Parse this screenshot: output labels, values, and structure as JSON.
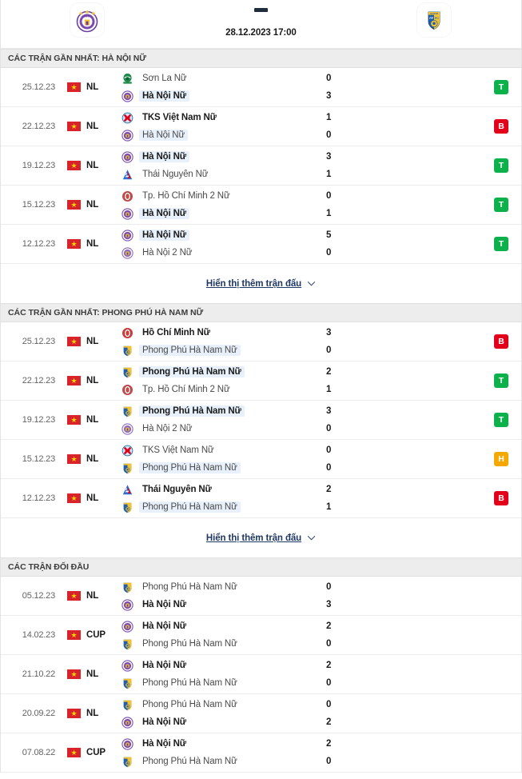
{
  "header": {
    "home_team": "Hà Nội Nữ",
    "away_team": "Phong Phú Hà Nam Nữ",
    "score_placeholder": "-",
    "kickoff": "28.12.2023 17:00",
    "home_crest_icon": "hanoi-crest-icon",
    "away_crest_icon": "phongphu-hanam-crest-icon"
  },
  "colors": {
    "win": "#0db14b",
    "loss": "#e2001a",
    "draw": "#f5a800",
    "highlight": "#e8f1fb",
    "section_bar": "#ededed",
    "link": "#1f3864",
    "flag_red": "#d8232a",
    "flag_star": "#ffd400"
  },
  "show_more_label": "Hiển thị thêm trận đấu",
  "sections": [
    {
      "title": "CÁC TRẬN GẦN NHẤT: HÀ NỘI NỮ",
      "has_show_more": true,
      "matches": [
        {
          "date": "25.12.23",
          "competition": "NL",
          "flag": "vietnam-flag",
          "home": {
            "name": "Sơn La Nữ",
            "logo": "sonla-logo",
            "bold": false,
            "highlight": false
          },
          "away": {
            "name": "Hà Nội Nữ",
            "logo": "hanoi-logo",
            "bold": true,
            "highlight": true
          },
          "home_score": "0",
          "away_score": "3",
          "result": "T",
          "result_type": "win"
        },
        {
          "date": "22.12.23",
          "competition": "NL",
          "flag": "vietnam-flag",
          "home": {
            "name": "TKS Việt Nam Nữ",
            "logo": "tks-logo",
            "bold": true,
            "highlight": false
          },
          "away": {
            "name": "Hà Nội Nữ",
            "logo": "hanoi-logo",
            "bold": false,
            "highlight": true
          },
          "home_score": "1",
          "away_score": "0",
          "result": "B",
          "result_type": "loss"
        },
        {
          "date": "19.12.23",
          "competition": "NL",
          "flag": "vietnam-flag",
          "home": {
            "name": "Hà Nội Nữ",
            "logo": "hanoi-logo",
            "bold": true,
            "highlight": true
          },
          "away": {
            "name": "Thái Nguyên Nữ",
            "logo": "thainguyen-logo",
            "bold": false,
            "highlight": false
          },
          "home_score": "3",
          "away_score": "1",
          "result": "T",
          "result_type": "win"
        },
        {
          "date": "15.12.23",
          "competition": "NL",
          "flag": "vietnam-flag",
          "home": {
            "name": "Tp. Hồ Chí Minh 2 Nữ",
            "logo": "hcm2-logo",
            "bold": false,
            "highlight": false
          },
          "away": {
            "name": "Hà Nội Nữ",
            "logo": "hanoi-logo",
            "bold": true,
            "highlight": true
          },
          "home_score": "0",
          "away_score": "1",
          "result": "T",
          "result_type": "win"
        },
        {
          "date": "12.12.23",
          "competition": "NL",
          "flag": "vietnam-flag",
          "home": {
            "name": "Hà Nội Nữ",
            "logo": "hanoi-logo",
            "bold": true,
            "highlight": true
          },
          "away": {
            "name": "Hà Nội 2 Nữ",
            "logo": "hanoi2-logo",
            "bold": false,
            "highlight": false
          },
          "home_score": "5",
          "away_score": "0",
          "result": "T",
          "result_type": "win"
        }
      ]
    },
    {
      "title": "CÁC TRẬN GẦN NHẤT: PHONG PHÚ HÀ NAM NỮ",
      "has_show_more": true,
      "matches": [
        {
          "date": "25.12.23",
          "competition": "NL",
          "flag": "vietnam-flag",
          "home": {
            "name": "Hồ Chí Minh Nữ",
            "logo": "hcm-logo",
            "bold": true,
            "highlight": false
          },
          "away": {
            "name": "Phong Phú Hà Nam Nữ",
            "logo": "phongphu-logo",
            "bold": false,
            "highlight": true
          },
          "home_score": "3",
          "away_score": "0",
          "result": "B",
          "result_type": "loss"
        },
        {
          "date": "22.12.23",
          "competition": "NL",
          "flag": "vietnam-flag",
          "home": {
            "name": "Phong Phú Hà Nam Nữ",
            "logo": "phongphu-logo",
            "bold": true,
            "highlight": true
          },
          "away": {
            "name": "Tp. Hồ Chí Minh 2 Nữ",
            "logo": "hcm2-logo",
            "bold": false,
            "highlight": false
          },
          "home_score": "2",
          "away_score": "1",
          "result": "T",
          "result_type": "win"
        },
        {
          "date": "19.12.23",
          "competition": "NL",
          "flag": "vietnam-flag",
          "home": {
            "name": "Phong Phú Hà Nam Nữ",
            "logo": "phongphu-logo",
            "bold": true,
            "highlight": true
          },
          "away": {
            "name": "Hà Nội 2 Nữ",
            "logo": "hanoi2-logo",
            "bold": false,
            "highlight": false
          },
          "home_score": "3",
          "away_score": "0",
          "result": "T",
          "result_type": "win"
        },
        {
          "date": "15.12.23",
          "competition": "NL",
          "flag": "vietnam-flag",
          "home": {
            "name": "TKS Việt Nam Nữ",
            "logo": "tks-logo",
            "bold": false,
            "highlight": false
          },
          "away": {
            "name": "Phong Phú Hà Nam Nữ",
            "logo": "phongphu-logo",
            "bold": false,
            "highlight": true
          },
          "home_score": "0",
          "away_score": "0",
          "result": "H",
          "result_type": "draw"
        },
        {
          "date": "12.12.23",
          "competition": "NL",
          "flag": "vietnam-flag",
          "home": {
            "name": "Thái Nguyên Nữ",
            "logo": "thainguyen-logo",
            "bold": true,
            "highlight": false
          },
          "away": {
            "name": "Phong Phú Hà Nam Nữ",
            "logo": "phongphu-logo",
            "bold": false,
            "highlight": true
          },
          "home_score": "2",
          "away_score": "1",
          "result": "B",
          "result_type": "loss"
        }
      ]
    },
    {
      "title": "CÁC TRẬN ĐỐI ĐẦU",
      "has_show_more": false,
      "matches": [
        {
          "date": "05.12.23",
          "competition": "NL",
          "flag": "vietnam-flag",
          "home": {
            "name": "Phong Phú Hà Nam Nữ",
            "logo": "phongphu-logo",
            "bold": false,
            "highlight": false
          },
          "away": {
            "name": "Hà Nội Nữ",
            "logo": "hanoi-logo",
            "bold": true,
            "highlight": false
          },
          "home_score": "0",
          "away_score": "3",
          "result": "",
          "result_type": "none"
        },
        {
          "date": "14.02.23",
          "competition": "CUP",
          "flag": "vietnam-flag",
          "home": {
            "name": "Hà Nội Nữ",
            "logo": "hanoi-logo",
            "bold": true,
            "highlight": false
          },
          "away": {
            "name": "Phong Phú Hà Nam Nữ",
            "logo": "phongphu-logo",
            "bold": false,
            "highlight": false
          },
          "home_score": "2",
          "away_score": "0",
          "result": "",
          "result_type": "none"
        },
        {
          "date": "21.10.22",
          "competition": "NL",
          "flag": "vietnam-flag",
          "home": {
            "name": "Hà Nội Nữ",
            "logo": "hanoi-logo",
            "bold": true,
            "highlight": false
          },
          "away": {
            "name": "Phong Phú Hà Nam Nữ",
            "logo": "phongphu-logo",
            "bold": false,
            "highlight": false
          },
          "home_score": "2",
          "away_score": "0",
          "result": "",
          "result_type": "none"
        },
        {
          "date": "20.09.22",
          "competition": "NL",
          "flag": "vietnam-flag",
          "home": {
            "name": "Phong Phú Hà Nam Nữ",
            "logo": "phongphu-logo",
            "bold": false,
            "highlight": false
          },
          "away": {
            "name": "Hà Nội Nữ",
            "logo": "hanoi-logo",
            "bold": true,
            "highlight": false
          },
          "home_score": "0",
          "away_score": "2",
          "result": "",
          "result_type": "none"
        },
        {
          "date": "07.08.22",
          "competition": "CUP",
          "flag": "vietnam-flag",
          "home": {
            "name": "Hà Nội Nữ",
            "logo": "hanoi-logo",
            "bold": true,
            "highlight": false
          },
          "away": {
            "name": "Phong Phú Hà Nam Nữ",
            "logo": "phongphu-logo",
            "bold": false,
            "highlight": false
          },
          "home_score": "2",
          "away_score": "0",
          "result": "",
          "result_type": "none"
        }
      ]
    }
  ]
}
